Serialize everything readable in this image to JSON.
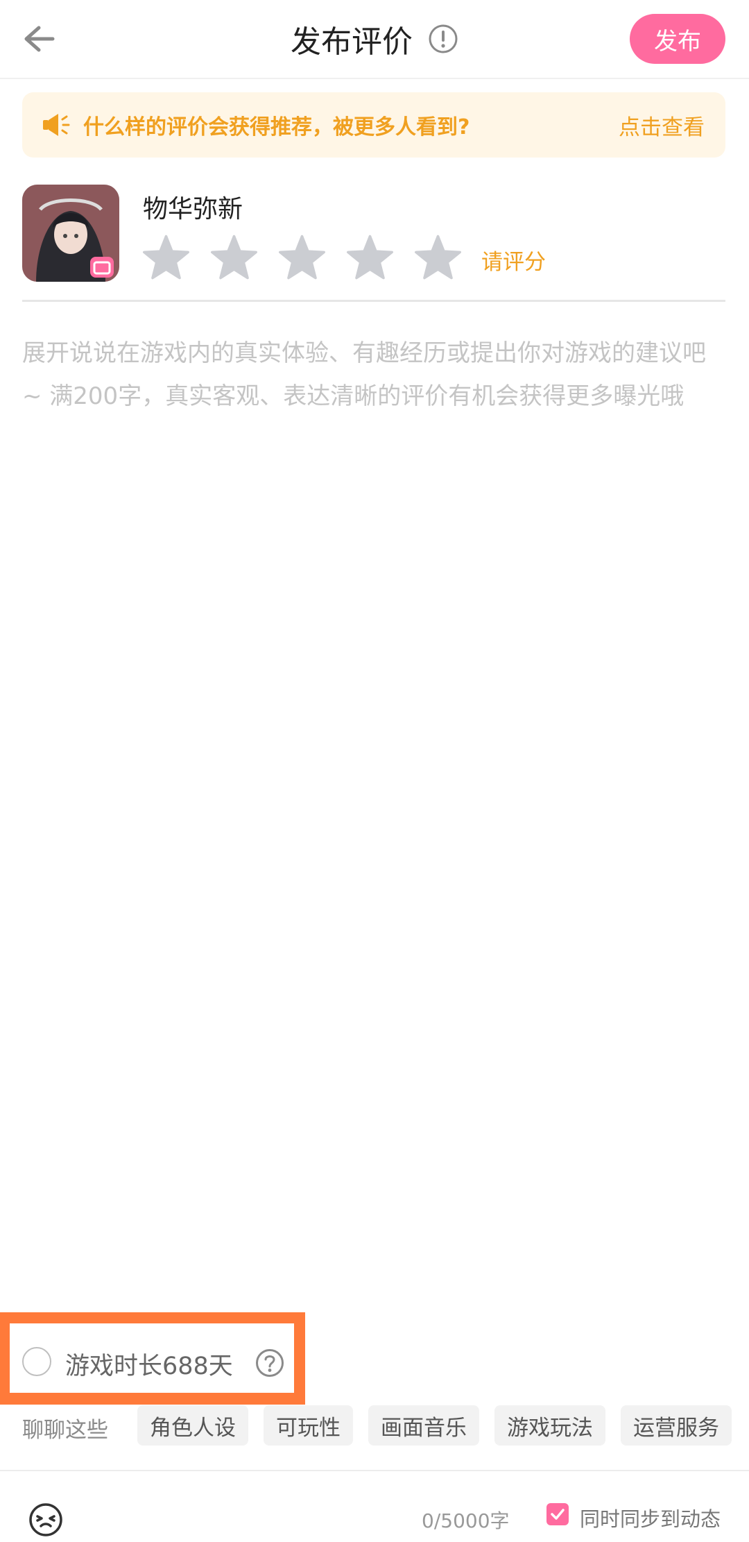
{
  "header": {
    "title": "发布评价",
    "publish_label": "发布"
  },
  "tip": {
    "text": "什么样的评价会获得推荐，被更多人看到?",
    "link_label": "点击查看"
  },
  "game": {
    "name": "物华弥新",
    "rating": 0,
    "rating_max": 5,
    "rate_hint": "请评分"
  },
  "review": {
    "value": "",
    "placeholder": "展开说说在游戏内的真实体验、有趣经历或提出你对游戏的建议吧~ 满200字，真实客观、表达清晰的评价有机会获得更多曝光哦"
  },
  "playtime": {
    "label": "游戏时长688天"
  },
  "topics": {
    "label": "聊聊这些",
    "tags": [
      "角色人设",
      "可玩性",
      "画面音乐",
      "游戏玩法",
      "运营服务"
    ]
  },
  "footer": {
    "char_count": "0/5000字",
    "sync_label": "同时同步到动态"
  },
  "colors": {
    "accent_pink": "#ff6b9f",
    "tip_orange": "#f0a020",
    "highlight_orange": "#ff7a3a"
  }
}
